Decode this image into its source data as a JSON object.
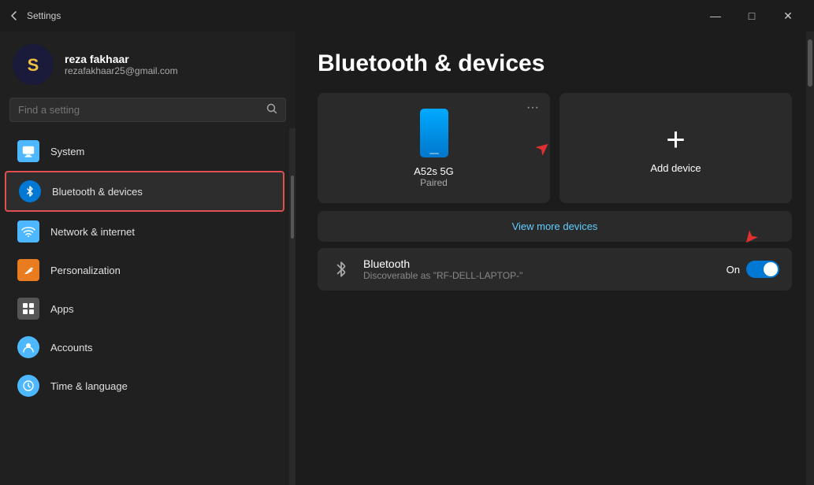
{
  "titlebar": {
    "title": "Settings",
    "minimize": "—",
    "maximize": "□",
    "close": "✕"
  },
  "sidebar": {
    "user": {
      "name": "reza fakhaar",
      "email": "rezafakhaar25@gmail.com",
      "avatar_initials": "S"
    },
    "search_placeholder": "Find a setting",
    "nav_items": [
      {
        "id": "system",
        "label": "System",
        "icon": "🖥"
      },
      {
        "id": "bluetooth",
        "label": "Bluetooth & devices",
        "icon": "⚡",
        "active": true
      },
      {
        "id": "network",
        "label": "Network & internet",
        "icon": "📶"
      },
      {
        "id": "personalization",
        "label": "Personalization",
        "icon": "✏"
      },
      {
        "id": "apps",
        "label": "Apps",
        "icon": "🧩"
      },
      {
        "id": "accounts",
        "label": "Accounts",
        "icon": "👤"
      },
      {
        "id": "time",
        "label": "Time & language",
        "icon": "🌐"
      }
    ]
  },
  "content": {
    "page_title": "Bluetooth & devices",
    "devices": [
      {
        "name": "A52s 5G",
        "status": "Paired",
        "more": "···"
      }
    ],
    "add_device_label": "Add device",
    "view_more_label": "View more devices",
    "bluetooth": {
      "label": "Bluetooth",
      "sub": "Discoverable as \"RF-DELL-LAPTOP-\"",
      "state": "On"
    }
  }
}
